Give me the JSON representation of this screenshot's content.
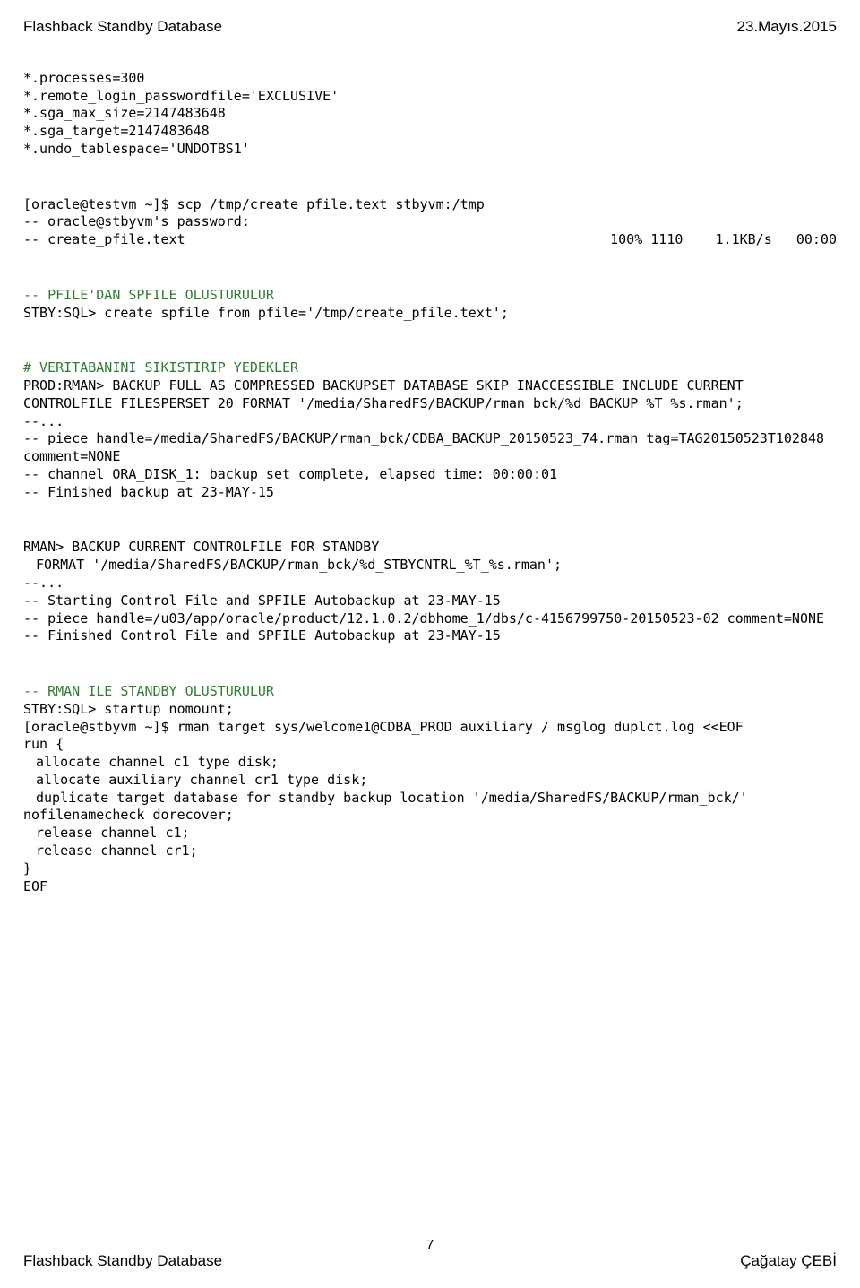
{
  "header": {
    "title": "Flashback Standby Database",
    "date": "23.Mayıs.2015"
  },
  "params": {
    "l1": "*.processes=300",
    "l2": "*.remote_login_passwordfile='EXCLUSIVE'",
    "l3": "*.sga_max_size=2147483648",
    "l4": "*.sga_target=2147483648",
    "l5": "*.undo_tablespace='UNDOTBS1'"
  },
  "scp": {
    "cmd": "[oracle@testvm ~]$ scp /tmp/create_pfile.text stbyvm:/tmp",
    "passprompt": "-- oracle@stbyvm's password:",
    "left": "-- create_pfile.text",
    "right": "100% 1110    1.1KB/s   00:00"
  },
  "spfile": {
    "comment": "-- PFILE'DAN SPFILE OLUSTURULUR",
    "cmd": "STBY:SQL> create spfile from pfile='/tmp/create_pfile.text';"
  },
  "backup": {
    "comment": "# VERITABANINI SIKISTIRIP YEDEKLER",
    "cmd": "PROD:RMAN> BACKUP FULL AS COMPRESSED BACKUPSET DATABASE SKIP INACCESSIBLE INCLUDE CURRENT CONTROLFILE FILESPERSET 20 FORMAT '/media/SharedFS/BACKUP/rman_bck/%d_BACKUP_%T_%s.rman';",
    "dots": "--...",
    "piece": "-- piece handle=/media/SharedFS/BACKUP/rman_bck/CDBA_BACKUP_20150523_74.rman tag=TAG20150523T102848 comment=NONE",
    "channel": "-- channel ORA_DISK_1: backup set complete, elapsed time: 00:00:01",
    "finished": "-- Finished backup at 23-MAY-15"
  },
  "stby_ctrl": {
    "cmd1": "RMAN> BACKUP CURRENT CONTROLFILE FOR STANDBY",
    "cmd2": "FORMAT '/media/SharedFS/BACKUP/rman_bck/%d_STBYCNTRL_%T_%s.rman';",
    "dots": "--...",
    "start": "-- Starting Control File and SPFILE Autobackup at 23-MAY-15",
    "piece": "-- piece handle=/u03/app/oracle/product/12.1.0.2/dbhome_1/dbs/c-4156799750-20150523-02 comment=NONE",
    "finished": "-- Finished Control File and SPFILE Autobackup at 23-MAY-15"
  },
  "rman_stby": {
    "comment": "-- RMAN ILE STANDBY OLUSTURULUR",
    "startup": "STBY:SQL> startup nomount;",
    "rmancmd": "[oracle@stbyvm ~]$ rman target sys/welcome1@CDBA_PROD auxiliary / msglog duplct.log <<EOF",
    "run": "run {",
    "alloc1": "allocate channel c1 type disk;",
    "alloc2": "allocate auxiliary channel cr1 type disk;",
    "dup": "duplicate target database for standby backup location '/media/SharedFS/BACKUP/rman_bck/' nofilenamecheck dorecover;",
    "rel1": "release channel c1;",
    "rel2": "release channel cr1;",
    "close": "}",
    "eof": "EOF"
  },
  "footer": {
    "left": "Flashback Standby Database",
    "pagenum": "7",
    "right": "Çağatay ÇEBİ"
  }
}
